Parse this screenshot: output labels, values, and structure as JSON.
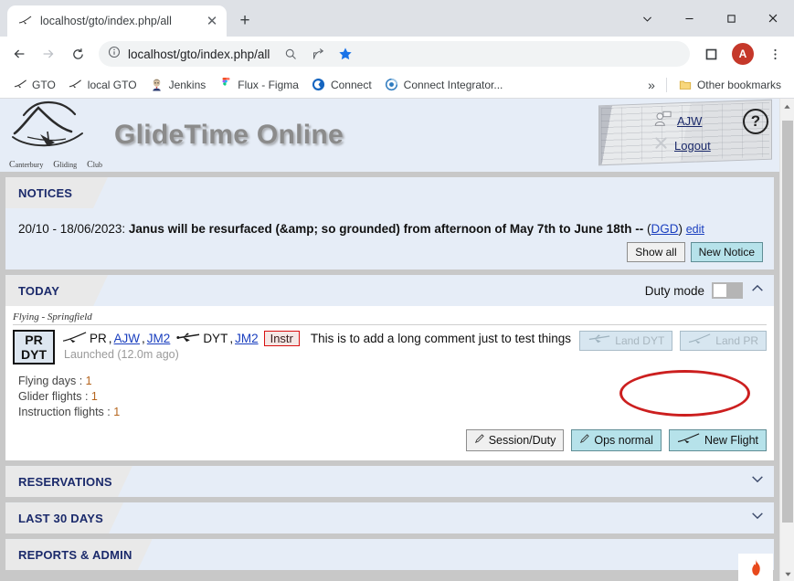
{
  "browser": {
    "tab": {
      "title": "localhost/gto/index.php/all",
      "favicon": "glider-icon",
      "close_label": "✕"
    },
    "new_tab_label": "+",
    "window_controls": {
      "tab_search": "tab-search-icon",
      "minimize": "—",
      "maximize": "□",
      "close": "✕"
    },
    "nav": {
      "back": "back-arrow-icon",
      "forward": "forward-arrow-icon",
      "reload": "reload-icon"
    },
    "omnibox": {
      "info_icon": "site-info-icon",
      "url": "localhost/gto/index.php/all"
    },
    "toolbar_icons": [
      "zoom-search-icon",
      "share-icon",
      "bookmark-star-icon",
      "extensions-icon"
    ],
    "profile_initial": "A",
    "menu_icon": "three-dot-menu-icon",
    "bookmarks": [
      {
        "label": "GTO",
        "icon": "glider-icon"
      },
      {
        "label": "local GTO",
        "icon": "glider-icon"
      },
      {
        "label": "Jenkins",
        "icon": "jenkins-butler-icon"
      },
      {
        "label": "Flux - Figma",
        "icon": "figma-icon"
      },
      {
        "label": "Connect",
        "icon": "connect-icon"
      },
      {
        "label": "Connect Integrator...",
        "icon": "connect-integrator-icon"
      }
    ],
    "bookmarks_overflow": "»",
    "other_bookmarks": {
      "label": "Other bookmarks",
      "icon": "folder-icon"
    }
  },
  "site": {
    "title": "GlideTime Online",
    "logo_caption": {
      "c1": "C",
      "w1": "anterbury",
      "c2": "G",
      "w2": "liding",
      "c3": "C",
      "w3": "lub"
    },
    "user": {
      "name": "AJW",
      "logout": "Logout"
    },
    "help_label": "?"
  },
  "notices": {
    "tab_label": "NOTICES",
    "item": {
      "date": "20/10 - 18/06/2023:",
      "text": "Janus will be resurfaced (&amp; so grounded) from afternoon of May 7th to June 18th --",
      "author_open": "(",
      "author": "DGD",
      "author_close": ")",
      "edit": "edit"
    },
    "show_all": "Show all",
    "new_notice": "New Notice"
  },
  "today": {
    "tab_label": "TODAY",
    "duty_mode": {
      "label": "Duty mode",
      "state": "off"
    },
    "session_header": "Flying - Springfield",
    "flight": {
      "reg_line1": "PR",
      "reg_line2": "DYT",
      "glider": {
        "icon": "glider-icon",
        "reg": "PR",
        "pilot1": "AJW",
        "pilot2": "JM2"
      },
      "tug": {
        "icon": "tug-plane-icon",
        "reg": "DYT",
        "pilot": "JM2"
      },
      "badge": "Instr",
      "comment": "This is to add a long comment just to test things",
      "status": "Launched (12.0m ago)",
      "land_tug": "Land DYT",
      "land_glider": "Land PR"
    },
    "stats": [
      {
        "label": "Flying days :",
        "value": "1"
      },
      {
        "label": "Glider flights :",
        "value": "1"
      },
      {
        "label": "Instruction flights :",
        "value": "1"
      }
    ],
    "actions": {
      "session_duty": "Session/Duty",
      "ops_normal": "Ops normal",
      "new_flight": "New Flight"
    }
  },
  "sections": [
    {
      "label": "RESERVATIONS",
      "state": "collapsed"
    },
    {
      "label": "LAST 30 DAYS",
      "state": "collapsed"
    },
    {
      "label": "REPORTS & ADMIN",
      "state": "collapsed"
    }
  ],
  "flame_badge": "flame-icon",
  "colors": {
    "accent_blue": "#1b2a6b",
    "link_blue": "#1a3fbf",
    "panel_bg": "#e6edf7",
    "cyan_button": "#b6e2ea",
    "annotation_red": "#cc1f1f",
    "stat_number": "#b5651d"
  }
}
